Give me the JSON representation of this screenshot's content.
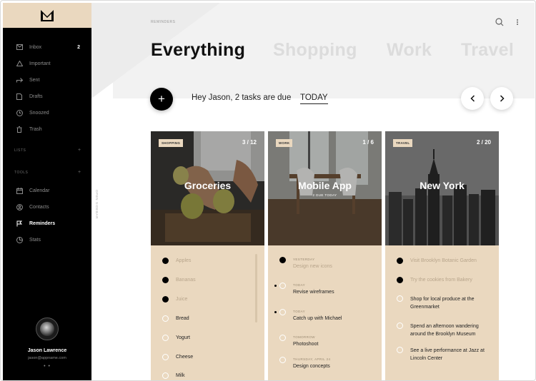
{
  "sidebar": {
    "items": [
      {
        "label": "Inbox",
        "icon": "inbox-icon",
        "count": "2"
      },
      {
        "label": "Important",
        "icon": "important-icon"
      },
      {
        "label": "Sent",
        "icon": "sent-icon"
      },
      {
        "label": "Drafts",
        "icon": "drafts-icon"
      },
      {
        "label": "Snoozed",
        "icon": "clock-icon"
      },
      {
        "label": "Trash",
        "icon": "trash-icon"
      }
    ],
    "lists_label": "LISTS",
    "tools_label": "TOOLS",
    "tools": [
      {
        "label": "Calendar",
        "icon": "calendar-icon"
      },
      {
        "label": "Contacts",
        "icon": "contacts-icon"
      },
      {
        "label": "Reminders",
        "icon": "flag-icon",
        "active": true
      },
      {
        "label": "Stats",
        "icon": "stats-icon"
      }
    ],
    "user": {
      "name": "Jason Lawrence",
      "email": "jason@appname.com"
    }
  },
  "side_strip": {
    "label": "OPEN SIDEBAR"
  },
  "header": {
    "breadcrumb": "REMINDERS",
    "tabs": [
      "Everything",
      "Shopping",
      "Work",
      "Travel"
    ],
    "active_tab": "Everything"
  },
  "greeting": {
    "text": "Hey Jason, 2 tasks are due",
    "due": "TODAY"
  },
  "colors": {
    "accent": "#ead8bf",
    "sidebar": "#000000",
    "text": "#111111"
  },
  "cards": [
    {
      "tag": "SHOPPING",
      "count": "3 / 12",
      "title": "Groceries",
      "items": [
        {
          "text": "Apples",
          "done": true
        },
        {
          "text": "Bananas",
          "done": true
        },
        {
          "text": "Juice",
          "done": true
        },
        {
          "text": "Bread",
          "done": false
        },
        {
          "text": "Yogurt",
          "done": false
        },
        {
          "text": "Cheese",
          "done": false
        },
        {
          "text": "Milk",
          "done": false
        }
      ]
    },
    {
      "tag": "WORK",
      "count": "1 / 6",
      "title": "Mobile App",
      "subtitle": "2 DUE TODAY",
      "items": [
        {
          "meta": "YESTERDAY",
          "text": "Design new icons",
          "done": true
        },
        {
          "meta": "TODAY",
          "text": "Revise wireframes",
          "done": false
        },
        {
          "meta": "TODAY",
          "text": "Catch up with Michael",
          "done": false
        },
        {
          "meta": "TOMORROW",
          "text": "Photoshoot",
          "done": false
        },
        {
          "meta": "THURSDAY, APRIL 24",
          "text": "Design concepts",
          "done": false
        }
      ]
    },
    {
      "tag": "TRAVEL",
      "count": "2 / 20",
      "title": "New York",
      "items": [
        {
          "text": "Visit Brooklyn Botanic Garden",
          "done": true
        },
        {
          "text": "Try the cookies from Bakery",
          "done": true
        },
        {
          "text": "Shop for local produce at the Greenmarket",
          "done": false
        },
        {
          "text": "Spend an afternoon wandering around the Brooklyn Museum",
          "done": false
        },
        {
          "text": "See a live performance at Jazz at Lincoln Center",
          "done": false
        }
      ]
    }
  ]
}
